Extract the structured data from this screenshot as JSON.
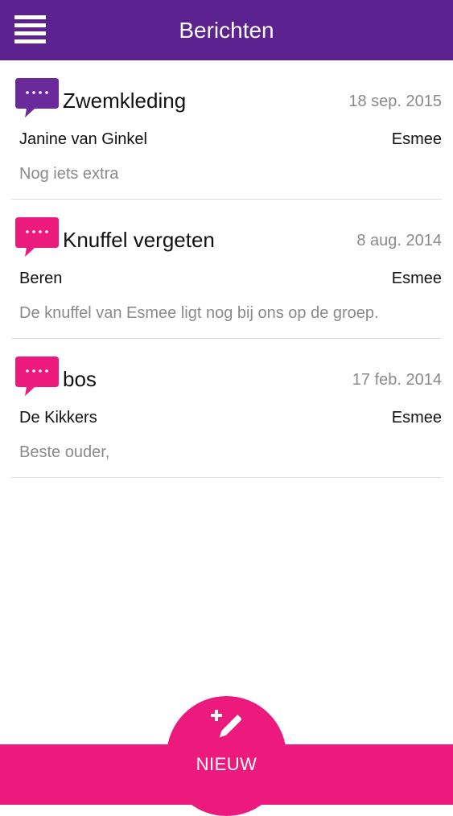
{
  "header": {
    "title": "Berichten",
    "menu_icon": "hamburger-menu-icon",
    "background_color": "#5b2290"
  },
  "messages": [
    {
      "subject": "Zwemkleding",
      "date": "18 sep. 2015",
      "sender": "Janine van Ginkel",
      "recipient": "Esmee",
      "preview": "Nog iets extra",
      "icon": "speech-bubble-icon",
      "icon_color": "#6a2a9c"
    },
    {
      "subject": "Knuffel vergeten",
      "date": "8 aug. 2014",
      "sender": "Beren",
      "recipient": "Esmee",
      "preview": "De knuffel van Esmee ligt nog bij ons op de groep.",
      "icon": "speech-bubble-icon",
      "icon_color": "#ec1a7d"
    },
    {
      "subject": "bos",
      "date": "17 feb. 2014",
      "sender": "De Kikkers",
      "recipient": "Esmee",
      "preview": "Beste ouder,",
      "icon": "speech-bubble-icon",
      "icon_color": "#ec1a7d"
    }
  ],
  "footer": {
    "new_label": "NIEUW",
    "new_icon": "compose-plus-pencil-icon",
    "background_color": "#ec1a7d"
  }
}
